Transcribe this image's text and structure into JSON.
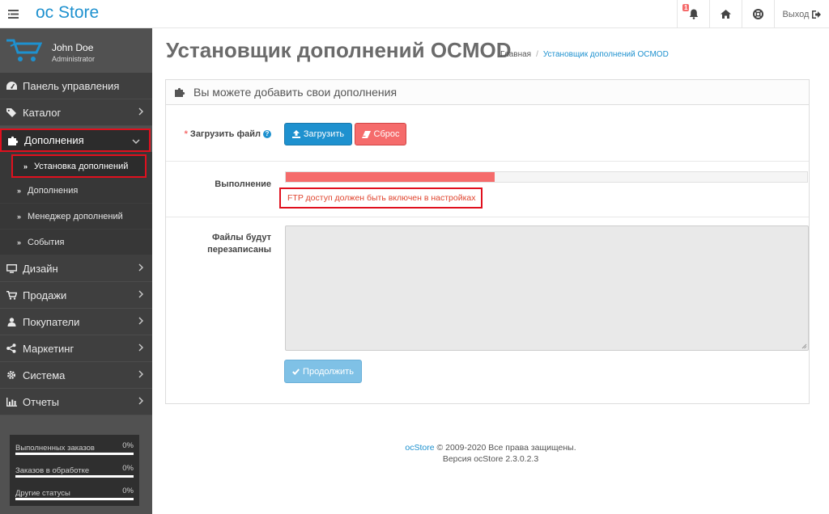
{
  "header": {
    "logo_oc": "oc",
    "logo_store": "Store",
    "notification_count": "1",
    "logout_label": "Выход"
  },
  "user": {
    "name": "John Doe",
    "role": "Administrator"
  },
  "sidebar": {
    "items": [
      {
        "label": "Панель управления"
      },
      {
        "label": "Каталог"
      },
      {
        "label": "Дополнения"
      },
      {
        "label": "Дизайн"
      },
      {
        "label": "Продажи"
      },
      {
        "label": "Покупатели"
      },
      {
        "label": "Маркетинг"
      },
      {
        "label": "Система"
      },
      {
        "label": "Отчеты"
      }
    ],
    "submenu": [
      {
        "label": "Установка дополнений"
      },
      {
        "label": "Дополнения"
      },
      {
        "label": "Менеджер дополнений"
      },
      {
        "label": "События"
      }
    ],
    "stats": [
      {
        "label": "Выполненных заказов",
        "value": "0%"
      },
      {
        "label": "Заказов в обработке",
        "value": "0%"
      },
      {
        "label": "Другие статусы",
        "value": "0%"
      }
    ]
  },
  "page": {
    "title": "Установщик дополнений OCMOD",
    "breadcrumb": [
      "Главная",
      "Установщик дополнений OCMOD"
    ],
    "panel_title": "Вы можете добавить свои дополнения",
    "upload_label": "Загрузить файл",
    "upload_button": "Загрузить",
    "reset_button": "Сброс",
    "progress_label": "Выполнение",
    "progress_fraction": 0.4,
    "ftp_message": "FTP доступ должен быть включен в настройках",
    "overwrite_label_1": "Файлы будут",
    "overwrite_label_2": "перезаписаны",
    "continue_button": "Продолжить"
  },
  "footer": {
    "brand": "ocStore",
    "copyright": "© 2009-2020 Все права защищены.",
    "version": "Версия ocStore 2.3.0.2.3"
  },
  "colors": {
    "accent": "#1e91cf",
    "danger": "#f56b6b",
    "highlight": "#e0101e",
    "sidebar": "#515151"
  }
}
